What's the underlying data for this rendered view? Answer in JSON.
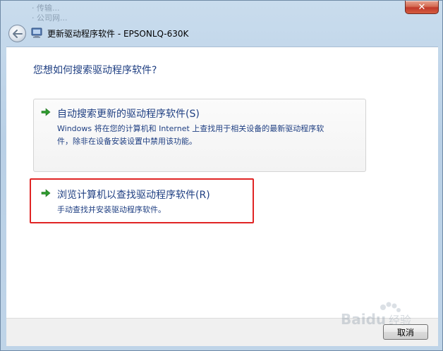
{
  "window": {
    "title": "更新驱动程序软件 - EPSONLQ-630K",
    "close_glyph": "✕",
    "background_text_1": "· 传输...",
    "background_text_2": "· 公司网..."
  },
  "main": {
    "question": "您想如何搜索驱动程序软件?",
    "options": [
      {
        "label": "自动搜索更新的驱动程序软件(S)",
        "desc_line1": "Windows 将在您的计算机和 Internet 上查找用于相关设备的最新驱动程序软",
        "desc_line2": "件，除非在设备安装设置中禁用该功能。"
      },
      {
        "label": "浏览计算机以查找驱动程序软件(R)",
        "desc_line1": "手动查找并安装驱动程序软件。"
      }
    ]
  },
  "footer": {
    "cancel_label": "取消",
    "watermark": "Baidu 经验"
  },
  "colors": {
    "link_blue": "#1f3f82",
    "arrow_green": "#2e9b2e",
    "highlight_red": "#e02424"
  },
  "icons": {
    "back": "back-arrow-icon",
    "wizard": "device-manager-icon",
    "option_arrow": "green-arrow-icon",
    "close": "close-icon"
  }
}
